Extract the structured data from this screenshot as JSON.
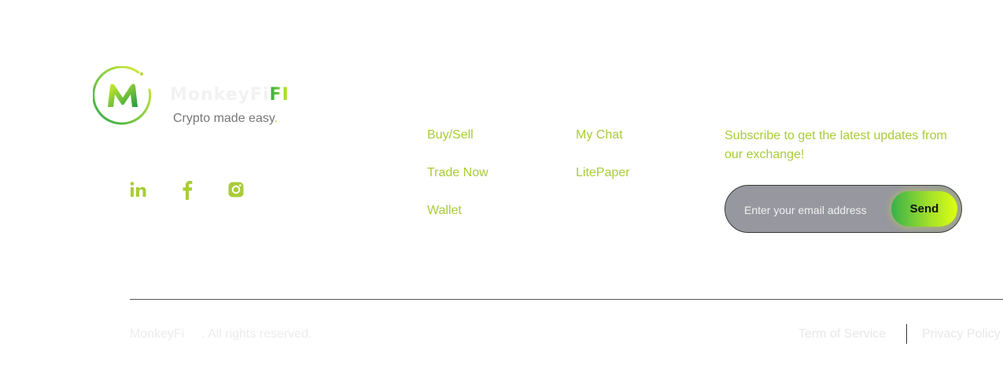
{
  "brand": {
    "name_main": "MonkeyFi",
    "name_suffix": "FI",
    "tagline": "Crypto made easy",
    "tagline_dot": ".",
    "logo_letter": "M"
  },
  "social": [
    {
      "icon": "linkedin-icon",
      "glyph": "in"
    },
    {
      "icon": "facebook-icon",
      "glyph": "f"
    },
    {
      "icon": "instagram-icon",
      "glyph": ""
    }
  ],
  "nav": {
    "col1": [
      "Buy/Sell",
      "Trade Now",
      "Wallet"
    ],
    "col2": [
      "My Chat",
      "LitePaper"
    ]
  },
  "subscribe": {
    "text": "Subscribe to get the latest updates from our exchange!",
    "placeholder": "Enter your email address",
    "button_label": "Send"
  },
  "footer": {
    "brand": "MonkeyFi",
    "rights": ". All rights reserved.",
    "terms": "Term of Service",
    "privacy": "Privacy Policy"
  },
  "colors": {
    "accent": "#a9cc37",
    "gradient_start": "#38b14a",
    "gradient_end": "#dbff12",
    "input_bg": "#97979f"
  }
}
